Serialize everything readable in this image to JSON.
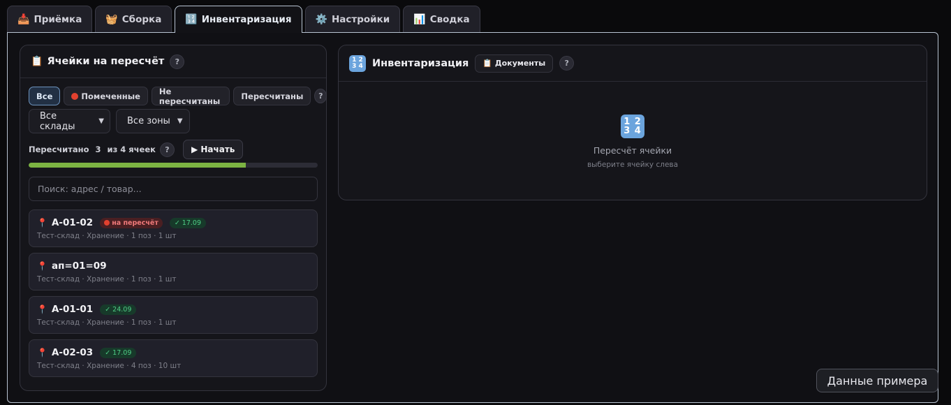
{
  "tabs": [
    {
      "icon": "📥",
      "label": "Приёмка"
    },
    {
      "icon": "🧺",
      "label": "Сборка"
    },
    {
      "icon": "🔢",
      "label": "Инвентаризация"
    },
    {
      "icon": "⚙️",
      "label": "Настройки"
    },
    {
      "icon": "📊",
      "label": "Сводка"
    }
  ],
  "left": {
    "title_icon": "📋",
    "title": "Ячейки на пересчёт",
    "help": "?",
    "filters": [
      {
        "label": "Все"
      },
      {
        "label": "Помеченные"
      },
      {
        "label": "Не пересчитаны"
      },
      {
        "label": "Пересчитаны"
      }
    ],
    "warehouse_select": "Все склады",
    "zone_select": "Все зоны",
    "progress": {
      "prefix": "Пересчитано",
      "done": "3",
      "suffix": "из 4 ячеек",
      "fraction": 0.75
    },
    "start_button": "▶ Начать",
    "search_placeholder": "Поиск: адрес / товар...",
    "cells": [
      {
        "address": "A-01-02",
        "flag": "на пересчёт",
        "date": "✓ 17.09",
        "meta": "Тест-склад · Хранение · 1 поз · 1 шт"
      },
      {
        "address": "ап=01=09",
        "flag": "",
        "date": "",
        "meta": "Тест-склад · Хранение · 1 поз · 1 шт"
      },
      {
        "address": "A-01-01",
        "flag": "",
        "date": "✓ 24.09",
        "meta": "Тест-склад · Хранение · 1 поз · 1 шт"
      },
      {
        "address": "A-02-03",
        "flag": "",
        "date": "✓ 17.09",
        "meta": "Тест-склад · Хранение · 4 поз · 10 шт"
      }
    ]
  },
  "right": {
    "title": "Инвентаризация",
    "docs_button": "📋 Документы",
    "empty_title": "Пересчёт ячейки",
    "empty_hint": "выберите ячейку слева"
  },
  "sample_button": "Данные примера",
  "colors": {
    "accent": "#6d93bd",
    "progress": "#7cb342",
    "danger": "#e2412f",
    "ok": "#4fcf86"
  }
}
